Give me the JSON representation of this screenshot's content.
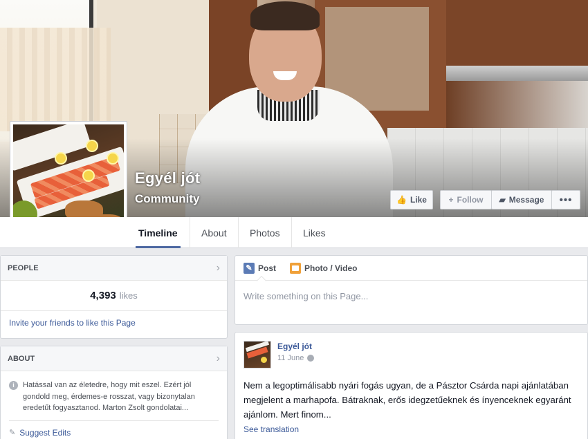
{
  "page": {
    "name": "Egyél jót",
    "category": "Community"
  },
  "actions": {
    "like": "Like",
    "follow": "Follow",
    "message": "Message",
    "more": "•••"
  },
  "tabs": [
    "Timeline",
    "About",
    "Photos",
    "Likes"
  ],
  "people": {
    "heading": "PEOPLE",
    "likes_count": "4,393",
    "likes_unit": "likes",
    "invite": "Invite your friends to like this Page"
  },
  "about": {
    "heading": "ABOUT",
    "text": "Hatással van az életedre, hogy mit eszel. Ezért jól gondold meg, érdemes-e rosszat, vagy bizonytalan eredetűt fogyasztanod. Marton Zsolt gondolatai...",
    "suggest": "Suggest Edits"
  },
  "composer": {
    "post_tab": "Post",
    "photo_tab": "Photo / Video",
    "placeholder": "Write something on this Page..."
  },
  "post": {
    "author": "Egyél jót",
    "date": "11 June",
    "text": "Nem a legoptimálisabb nyári fogás ugyan, de a Pásztor Csárda napi ajánlatában megjelent a marhapofa. Bátraknak, erős idegzetűeknek és ínyenceknek egyaránt ajánlom. Mert finom...",
    "see_translation": "See translation"
  },
  "colors": {
    "link": "#3b5998",
    "tab_underline": "#4e69a2",
    "page_bg": "#e9eaed"
  }
}
